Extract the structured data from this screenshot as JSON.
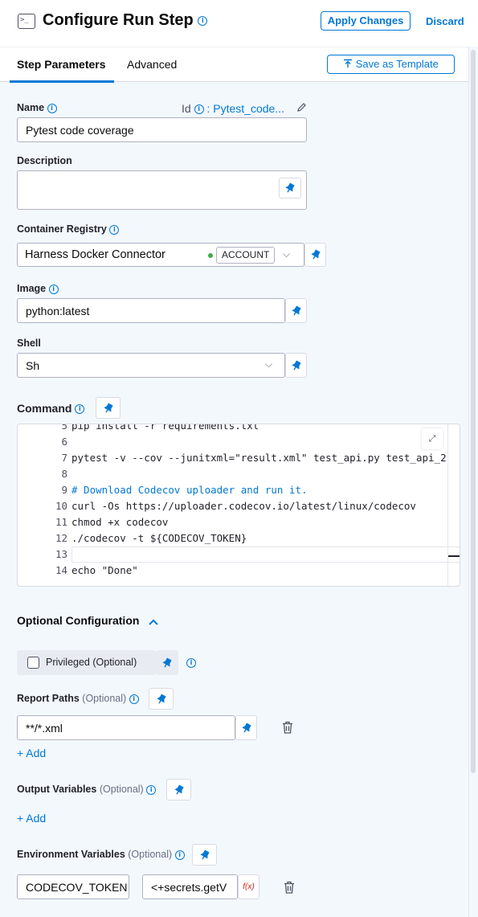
{
  "header": {
    "title": "Configure Run Step",
    "apply_label": "Apply Changes",
    "discard_label": "Discard"
  },
  "tabs": [
    {
      "label": "Step Parameters",
      "active": true
    },
    {
      "label": "Advanced",
      "active": false
    }
  ],
  "save_template_label": "Save as Template",
  "fields": {
    "name": {
      "label": "Name",
      "value": "Pytest code coverage"
    },
    "id": {
      "label": "Id",
      "value": ": Pytest_code..."
    },
    "description": {
      "label": "Description",
      "value": ""
    },
    "container_registry": {
      "label": "Container Registry",
      "value": "Harness Docker Connector",
      "scope": "ACCOUNT",
      "status_color": "#42ab45"
    },
    "image": {
      "label": "Image",
      "value": "python:latest"
    },
    "shell": {
      "label": "Shell",
      "value": "Sh"
    }
  },
  "command": {
    "label": "Command",
    "lines": [
      {
        "num": "5",
        "text": "pip install -r requirements.txt"
      },
      {
        "num": "6",
        "text": ""
      },
      {
        "num": "7",
        "text": "pytest -v --cov --junitxml=\"result.xml\" test_api.py test_api_2"
      },
      {
        "num": "8",
        "text": ""
      },
      {
        "num": "9",
        "text": "# Download Codecov uploader and run it."
      },
      {
        "num": "10",
        "text": "curl -Os https://uploader.codecov.io/latest/linux/codecov"
      },
      {
        "num": "11",
        "text": "chmod +x codecov"
      },
      {
        "num": "12",
        "text": "./codecov -t ${CODECOV_TOKEN}"
      },
      {
        "num": "13",
        "text": ""
      },
      {
        "num": "14",
        "text": "echo \"Done\""
      }
    ]
  },
  "optional": {
    "section_title": "Optional Configuration",
    "privileged_label": "Privileged (Optional)",
    "report_paths": {
      "label": "Report Paths",
      "optional": "(Optional)",
      "value": "**/*.xml",
      "add_label": "+ Add"
    },
    "output_variables": {
      "label": "Output Variables",
      "optional": "(Optional)",
      "add_label": "+ Add"
    },
    "env_variables": {
      "label": "Environment Variables",
      "optional": "(Optional)",
      "key": "CODECOV_TOKEN",
      "value": "<+secrets.getV",
      "fx_label": "f(x)"
    }
  },
  "colors": {
    "accent": "#0278d5",
    "background": "#f3f8fd"
  }
}
